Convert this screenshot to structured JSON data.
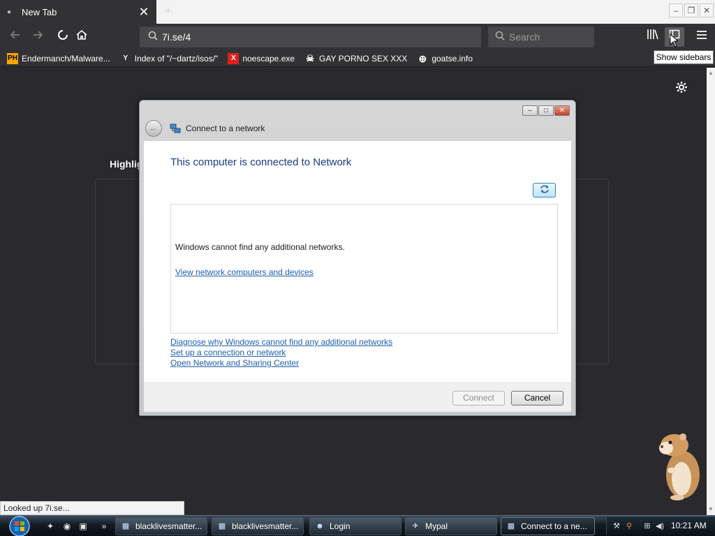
{
  "browser": {
    "tab": {
      "title": "New Tab",
      "close": "✕"
    },
    "new_tab_symbol": "+",
    "window_controls": {
      "minimize": "–",
      "restore": "❐",
      "close": "✕"
    },
    "url": "7i.se/4",
    "search_placeholder": "Search",
    "tooltip": "Show sidebars",
    "bookmarks": [
      {
        "icon": "PH",
        "label": "Endermanch/Malware..."
      },
      {
        "icon": "Y",
        "label": "Index of \"/~dartz/isos/\""
      },
      {
        "icon": "X",
        "label": "noescape.exe"
      },
      {
        "icon": "☠",
        "label": "GAY PORNO SEX XXX"
      },
      {
        "icon": "⊕",
        "label": "goatse.info"
      }
    ],
    "page": {
      "highlights_label": "Highlig"
    },
    "status": "Looked up 7i.se..."
  },
  "dialog": {
    "caption": "Connect to a network",
    "heading": "This computer is connected to Network",
    "list_message": "Windows cannot find any additional networks.",
    "list_link": "View network computers and devices",
    "links": [
      "Diagnose why Windows cannot find any additional networks",
      "Set up a connection or network",
      "Open Network and Sharing Center"
    ],
    "buttons": {
      "connect": "Connect",
      "cancel": "Cancel"
    }
  },
  "taskbar": {
    "items": [
      {
        "label": "blacklivesmatter...",
        "active": false
      },
      {
        "label": "blacklivesmatter...",
        "active": false
      },
      {
        "label": "Login",
        "active": false
      },
      {
        "label": "Mypal",
        "active": false
      },
      {
        "label": "Connect to a ne...",
        "active": true
      }
    ],
    "clock": "10:21 AM"
  },
  "colors": {
    "browser_dark": "#2a2a2e",
    "toolbar": "#323234",
    "dialog_heading": "#1e3a87",
    "link": "#1f5fb0"
  }
}
